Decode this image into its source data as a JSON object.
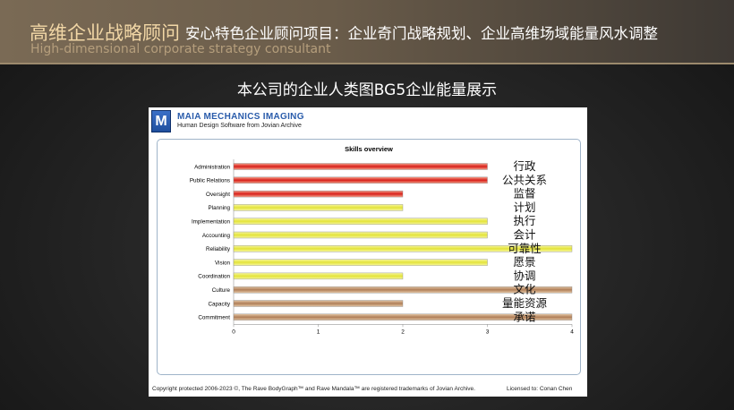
{
  "header": {
    "brand": "高维企业战略顾问",
    "tagline": "安心特色企业顾问项目：企业奇门战略规划、企业高维场域能量风水调整",
    "subtitle_en": "High-dimensional corporate strategy consultant"
  },
  "slide_title": "本公司的企业人类图BG5企业能量展示",
  "app": {
    "logo_letter": "M",
    "name": "MAIA MECHANICS IMAGING",
    "sub": "Human Design Software from Jovian Archive",
    "copyright": "Copyright protected 2006-2023 ©, The Rave BodyGraph™ and Rave Mandala™ are registered trademarks of Jovian Archive.",
    "license": "Licensed to: Conan Chen"
  },
  "chart_data": {
    "type": "bar",
    "orientation": "horizontal",
    "title": "Skills overview",
    "categories": [
      "Administration",
      "Public Relations",
      "Oversight",
      "Planning",
      "Implementation",
      "Accounting",
      "Reliability",
      "Vision",
      "Coordination",
      "Culture",
      "Capacity",
      "Commitment"
    ],
    "values": [
      3,
      3,
      2,
      2,
      3,
      3,
      4,
      3,
      2,
      4,
      2,
      4
    ],
    "colors": [
      "red",
      "red",
      "red",
      "yellow",
      "yellow",
      "yellow",
      "yellow",
      "yellow",
      "yellow",
      "brown",
      "brown",
      "brown"
    ],
    "annotations": [
      "行政",
      "公共关系",
      "监督",
      "计划",
      "执行",
      "会计",
      "可靠性",
      "愿景",
      "协调",
      "文化",
      "量能资源",
      "承诺"
    ],
    "x_ticks": [
      "0",
      "1",
      "2",
      "3",
      "4"
    ],
    "xlim": [
      0,
      4
    ]
  }
}
